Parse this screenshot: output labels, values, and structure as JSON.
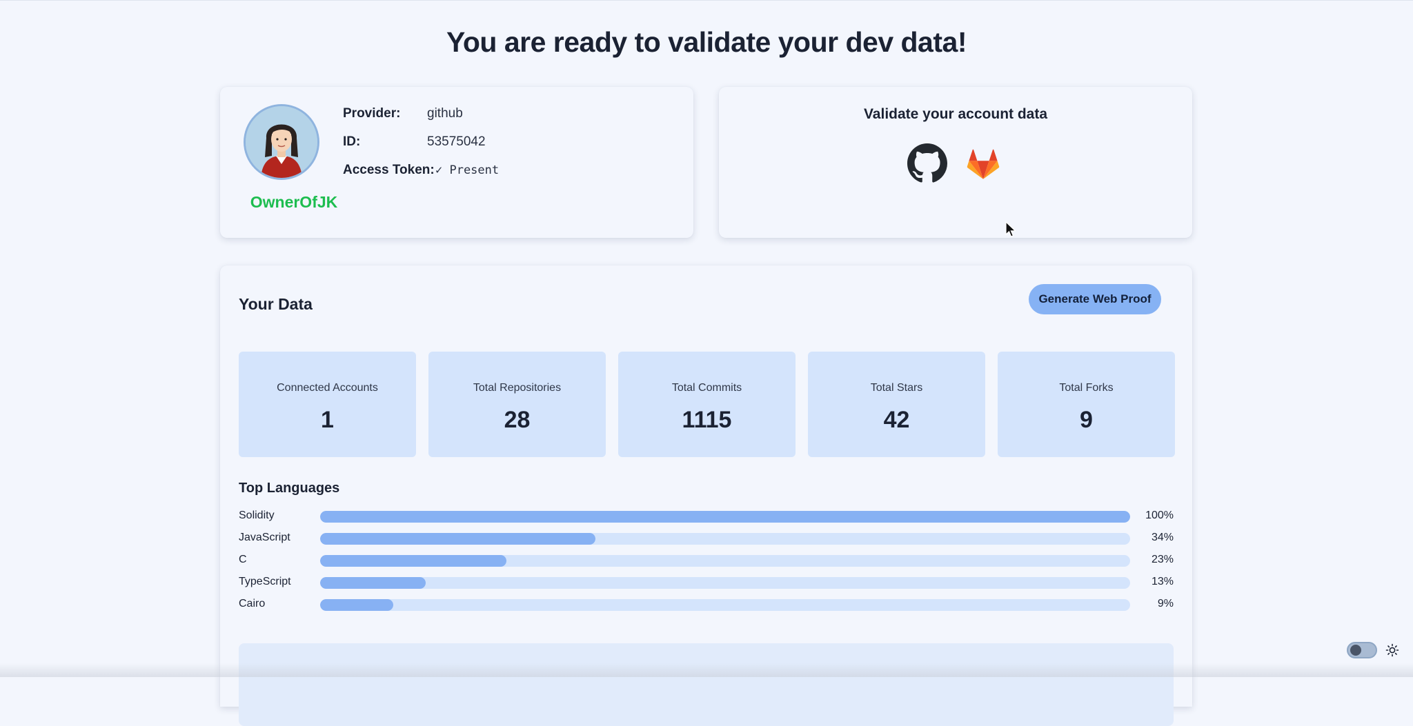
{
  "page": {
    "title": "You are ready to validate your dev data!"
  },
  "profile": {
    "username": "OwnerOfJK",
    "fields": [
      {
        "label": "Provider:",
        "value": "github"
      },
      {
        "label": "ID:",
        "value": "53575042"
      },
      {
        "label": "Access Token:",
        "value": "✓ Present"
      }
    ]
  },
  "validate": {
    "title": "Validate your account data",
    "providers": [
      {
        "icon": "github-icon"
      },
      {
        "icon": "gitlab-icon"
      }
    ]
  },
  "data": {
    "title": "Your Data",
    "generate_button": "Generate Web Proof",
    "stats": [
      {
        "label": "Connected Accounts",
        "value": "1"
      },
      {
        "label": "Total Repositories",
        "value": "28"
      },
      {
        "label": "Total Commits",
        "value": "1115"
      },
      {
        "label": "Total Stars",
        "value": "42"
      },
      {
        "label": "Total Forks",
        "value": "9"
      }
    ],
    "languages_title": "Top Languages",
    "languages": [
      {
        "name": "Solidity",
        "percent": 100,
        "label": "100%"
      },
      {
        "name": "JavaScript",
        "percent": 34,
        "label": "34%"
      },
      {
        "name": "C",
        "percent": 23,
        "label": "23%"
      },
      {
        "name": "TypeScript",
        "percent": 13,
        "label": "13%"
      },
      {
        "name": "Cairo",
        "percent": 9,
        "label": "9%"
      }
    ]
  },
  "colors": {
    "background": "#f3f6fd",
    "accent": "#86b2f4",
    "stat_box": "#d4e4fc",
    "username": "#1dbd4f"
  }
}
